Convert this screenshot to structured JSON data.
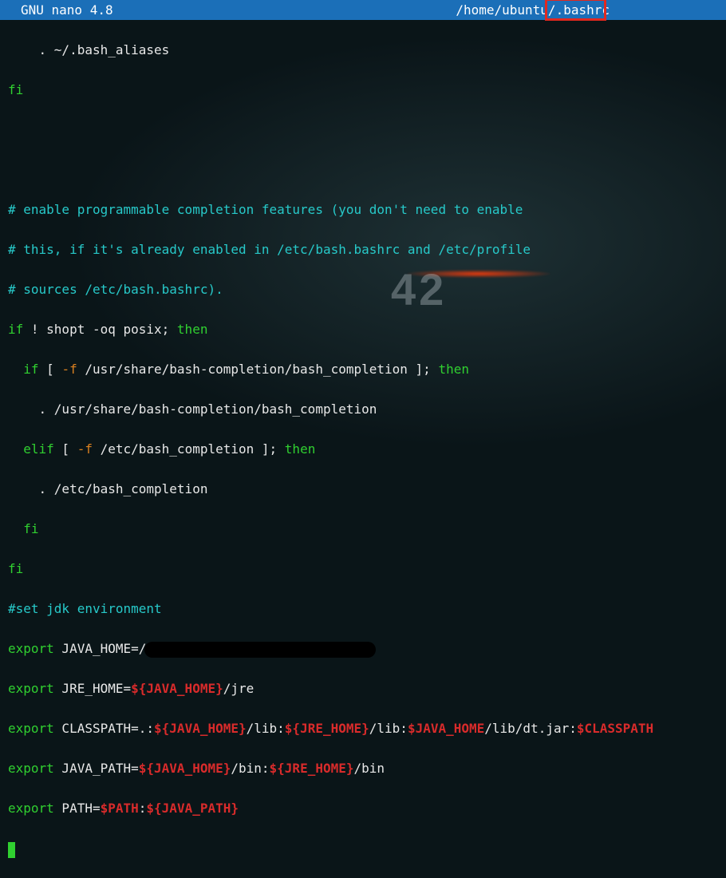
{
  "titlebar": {
    "app": "GNU nano 4.8",
    "filepath_dir": "/home/ubuntu/",
    "filepath_name": ".bashrc"
  },
  "bg": {
    "number": "42"
  },
  "lines": {
    "l1a": "    . ~/.bash_aliases",
    "l2a": "fi",
    "l4a": "# enable programmable completion features (you don't need to enable",
    "l5a": "# this, if it's already enabled in /etc/bash.bashrc and /etc/profile",
    "l6a": "# sources /etc/bash.bashrc).",
    "l7a": "if",
    "l7b": " ! shopt -oq posix; ",
    "l7c": "then",
    "l8a": "  if",
    "l8b": " [ ",
    "l8c": "-f",
    "l8d": " /usr/share/bash-completion/bash_completion ]; ",
    "l8e": "then",
    "l9a": "    . /usr/share/bash-completion/bash_completion",
    "l10a": "  elif",
    "l10b": " [ ",
    "l10c": "-f",
    "l10d": " /etc/bash_completion ]; ",
    "l10e": "then",
    "l11a": "    . /etc/bash_completion",
    "l12a": "  fi",
    "l13a": "fi",
    "l14a": "#set jdk environment",
    "l15a": "export",
    "l15b": " JAVA_HOME=/",
    "l16a": "export",
    "l16b": " JRE_HOME=",
    "l16c": "${JAVA_HOME}",
    "l16d": "/jre",
    "l17a": "export",
    "l17b": " CLASSPATH=.:",
    "l17c": "${JAVA_HOME}",
    "l17d": "/lib:",
    "l17e": "${JRE_HOME}",
    "l17f": "/lib:",
    "l17g": "$JAVA_HOME",
    "l17h": "/lib/dt.jar:",
    "l17i": "$CLASSPATH",
    "l18a": "export",
    "l18b": " JAVA_PATH=",
    "l18c": "${JAVA_HOME}",
    "l18d": "/bin:",
    "l18e": "${JRE_HOME}",
    "l18f": "/bin",
    "l19a": "export",
    "l19b": " PATH=",
    "l19c": "$PATH",
    "l19d": ":",
    "l19e": "${JAVA_PATH}"
  }
}
